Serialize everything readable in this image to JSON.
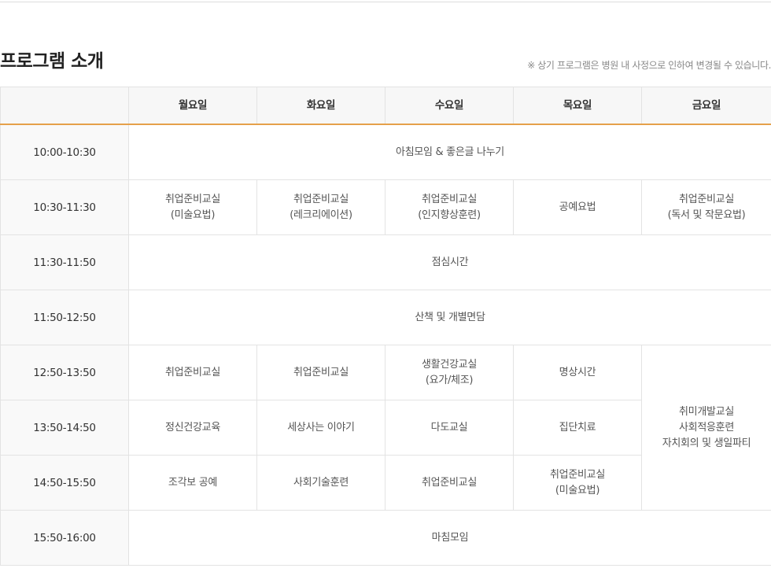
{
  "section": {
    "title": "프로그램 소개",
    "note": "※ 상기 프로그램은 병원 내 사정으로 인하여 변경될 수 있습니다."
  },
  "table": {
    "headers": [
      "",
      "월요일",
      "화요일",
      "수요일",
      "목요일",
      "금요일"
    ],
    "rows": [
      {
        "time": "10:00-10:30",
        "all": "아침모임 & 좋은글 나누기"
      },
      {
        "time": "10:30-11:30",
        "mon": [
          "취업준비교실",
          "(미술요법)"
        ],
        "tue": [
          "취업준비교실",
          "(레크리에이션)"
        ],
        "wed": [
          "취업준비교실",
          "(인지향상훈련)"
        ],
        "thu": "공예요법",
        "fri": [
          "취업준비교실",
          "(독서 및 작문요법)"
        ]
      },
      {
        "time": "11:30-11:50",
        "all": "점심시간"
      },
      {
        "time": "11:50-12:50",
        "all": "산책 및 개별면담"
      },
      {
        "time": "12:50-13:50",
        "mon": "취업준비교실",
        "tue": "취업준비교실",
        "wed": [
          "생활건강교실",
          "(요가/체조)"
        ],
        "thu": "명상시간"
      },
      {
        "time": "13:50-14:50",
        "mon": "정신건강교육",
        "tue": "세상사는 이야기",
        "wed": "다도교실",
        "thu": "집단치료"
      },
      {
        "time": "14:50-15:50",
        "mon": "조각보 공예",
        "tue": "사회기술훈련",
        "wed": "취업준비교실",
        "thu": [
          "취업준비교실",
          "(미술요법)"
        ]
      },
      {
        "time": "15:50-16:00",
        "all": "마침모임"
      }
    ],
    "friday_afternoon": [
      "취미개발교실",
      "사회적응훈련",
      "자치회의 및 생일파티"
    ]
  }
}
